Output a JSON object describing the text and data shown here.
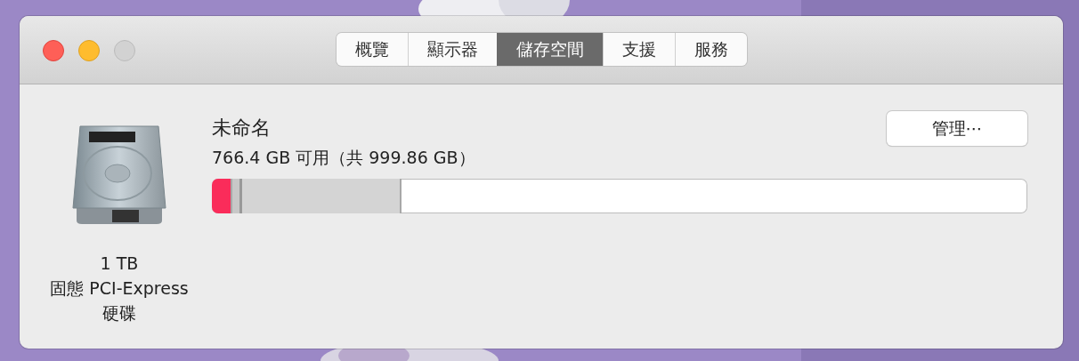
{
  "window": {
    "tabs": [
      {
        "label": "概覽",
        "selected": false
      },
      {
        "label": "顯示器",
        "selected": false
      },
      {
        "label": "儲存空間",
        "selected": true
      },
      {
        "label": "支援",
        "selected": false
      },
      {
        "label": "服務",
        "selected": false
      }
    ]
  },
  "disk": {
    "capacity": "1 TB",
    "type": "固態 PCI-Express",
    "type_suffix": "硬碟"
  },
  "volume": {
    "name": "未命名",
    "summary": "766.4 GB 可用（共 999.86 GB）",
    "manage_button": "管理⋯",
    "segments": [
      {
        "kind": "solid",
        "color": "#fa2c5a",
        "level": 0.025
      },
      {
        "kind": "striped",
        "color": "#c8c8c8",
        "level": 0.037
      },
      {
        "kind": "solid",
        "color": "#d4d4d4",
        "level": 0.233
      }
    ]
  }
}
